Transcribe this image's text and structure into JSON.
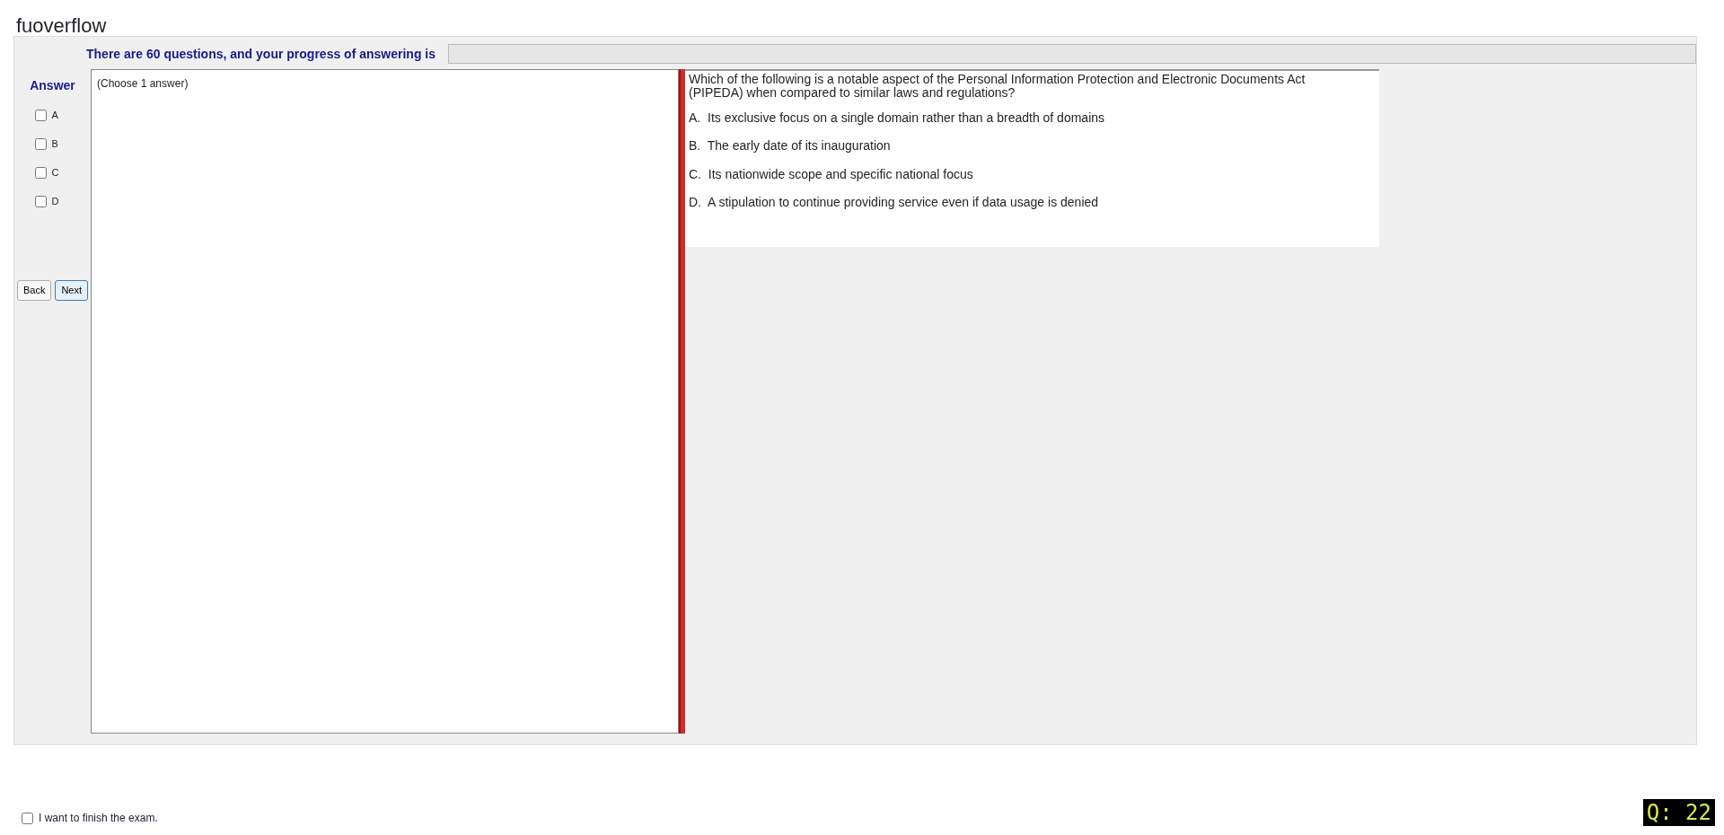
{
  "brand": "fuoverflow",
  "progress": {
    "label": "There are 60 questions, and your progress of answering is",
    "level": 0
  },
  "answer": {
    "title": "Answer",
    "options": [
      {
        "label": "A",
        "checked": false
      },
      {
        "label": "B",
        "checked": false
      },
      {
        "label": "C",
        "checked": false
      },
      {
        "label": "D",
        "checked": false
      }
    ]
  },
  "buttons": [
    {
      "label": "Back",
      "selected": false
    },
    {
      "label": "Next",
      "selected": true
    }
  ],
  "instruction": "(Choose 1 answer)",
  "question": {
    "text": "Which of the following is a notable aspect of the Personal Information Protection and Electronic Documents Act (PIPEDA) when compared to similar laws and regulations?",
    "choices": [
      "A.  Its exclusive focus on a single domain rather than a breadth of domains",
      "B.  The early date of its inauguration",
      "C.  Its nationwide scope and specific national focus",
      "D.  A stipulation to continue providing service even if data usage is denied"
    ]
  },
  "finish": {
    "label": "I want to finish the exam.",
    "checked": false
  },
  "counter": "Q: 22"
}
